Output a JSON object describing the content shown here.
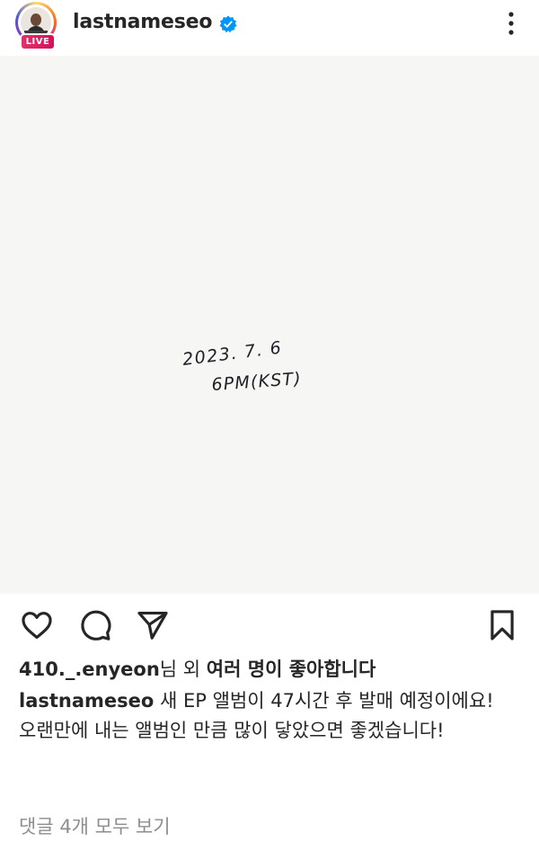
{
  "header": {
    "username": "lastnameseo",
    "live_badge": "LIVE",
    "verified_icon": "verified-badge-icon",
    "more_icon": "more-vertical-icon"
  },
  "post": {
    "handwriting": {
      "line1": "2023. 7. 6",
      "line2": "6PM(KST)"
    }
  },
  "actions": {
    "like_icon": "heart-icon",
    "comment_icon": "comment-icon",
    "share_icon": "send-icon",
    "save_icon": "bookmark-icon"
  },
  "likes": {
    "user": "410._.enyeon",
    "suffix_mid": "님 외 ",
    "suffix_bold": "여러 명이 좋아합니다"
  },
  "caption": {
    "username": "lastnameseo",
    "line1": " 새 EP 앨범이 47시간 후 발매 예정이에요!",
    "line2": "오랜만에 내는 앨범인 만큼 많이 닿았으면 좋겠습니다!"
  },
  "comments_link": "댓글 4개 모두 보기",
  "colors": {
    "text": "#262626",
    "muted": "#8e8e8e",
    "verified": "#0095f6",
    "live": "#e1306c",
    "photo_bg": "#f6f6f4"
  }
}
